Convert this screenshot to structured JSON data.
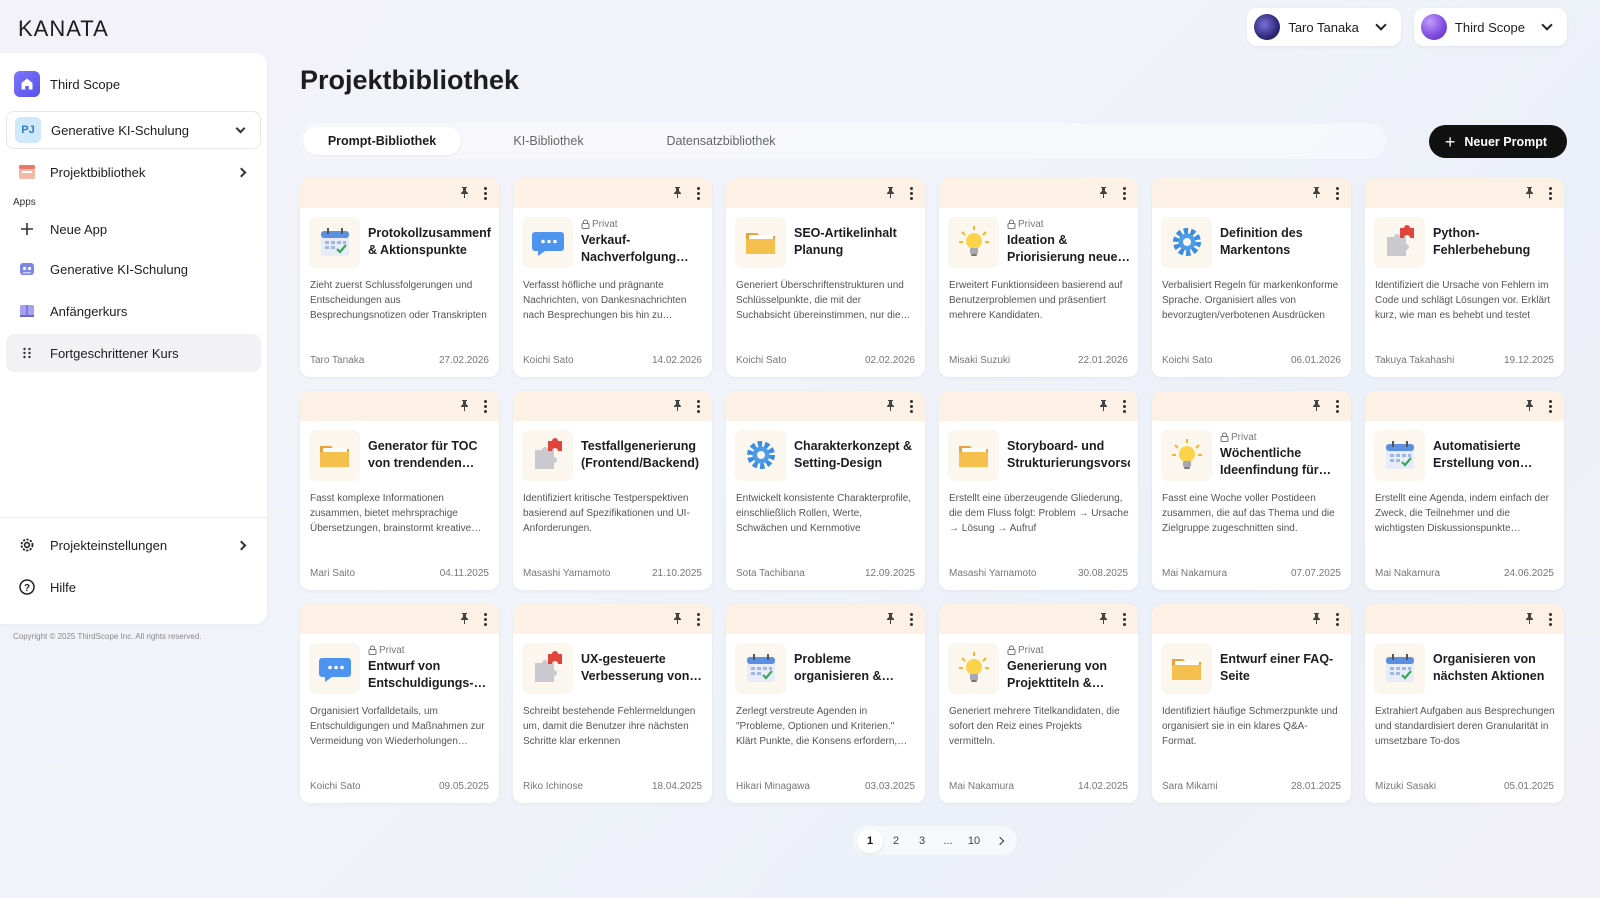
{
  "brand": {
    "logo": "KANATA"
  },
  "header": {
    "user": {
      "name": "Taro Tanaka"
    },
    "scope": {
      "name": "Third Scope"
    }
  },
  "sidebar": {
    "scope_label": "Third Scope",
    "project": {
      "badge": "PJ",
      "name": "Generative KI-Schulung"
    },
    "library": "Projektbibliothek",
    "apps_label": "Apps",
    "apps": [
      {
        "label": "Neue App",
        "icon": "plus-icon"
      },
      {
        "label": "Generative KI-Schulung",
        "icon": "robot-icon"
      },
      {
        "label": "Anfängerkurs",
        "icon": "book-icon"
      },
      {
        "label": "Fortgeschrittener Kurs",
        "icon": "grid-dots-icon"
      }
    ],
    "settings": "Projekteinstellungen",
    "help": "Hilfe",
    "copyright": "Copyright © 2025 ThirdScope Inc. All rights reserved."
  },
  "main": {
    "title": "Projektbibliothek",
    "tabs": [
      "Prompt-Bibliothek",
      "KI-Bibliothek",
      "Datensatzbibliothek"
    ],
    "active_tab": 0,
    "new_button": "Neuer Prompt",
    "private_label": "Privat",
    "cards": [
      {
        "icon": "calendar",
        "private": false,
        "title": "Protokollzusammenfassung & Aktionspunkte",
        "desc": "Zieht zuerst Schlussfolgerungen und Entscheidungen aus Besprechungsnotizen oder Transkripten",
        "author": "Taro Tanaka",
        "date": "27.02.2026"
      },
      {
        "icon": "chat",
        "private": true,
        "title": "Verkauf-Nachverfolgung Dankesnachricht",
        "desc": "Verfasst höfliche und prägnante Nachrichten, von Dankesnachrichten nach Besprechungen bis hin zu Vorschlägen",
        "author": "Koichi Sato",
        "date": "14.02.2026"
      },
      {
        "icon": "folder",
        "private": false,
        "title": "SEO-Artikelinhalt Planung",
        "desc": "Generiert Überschriftenstrukturen und Schlüsselpunkte, die mit der Suchabsicht übereinstimmen, nur die wichtigsten",
        "author": "Koichi Sato",
        "date": "02.02.2026"
      },
      {
        "icon": "bulb",
        "private": true,
        "title": "Ideation & Priorisierung neuer Features",
        "desc": "Erweitert Funktionsideen basierend auf Benutzerproblemen und präsentiert mehrere Kandidaten.",
        "author": "Misaki Suzuki",
        "date": "22.01.2026"
      },
      {
        "icon": "gear",
        "private": false,
        "title": "Definition des Markentons",
        "desc": "Verbalisiert Regeln für markenkonforme Sprache. Organisiert alles von bevorzugten/verbotenen Ausdrücken",
        "author": "Koichi Sato",
        "date": "06.01.2026"
      },
      {
        "icon": "puzzle",
        "private": false,
        "title": "Python-Fehlerbehebung",
        "desc": "Identifiziert die Ursache von Fehlern im Code und schlägt Lösungen vor. Erklärt kurz, wie man es behebt und testet",
        "author": "Takuya Takahashi",
        "date": "19.12.2025"
      },
      {
        "icon": "folder",
        "private": false,
        "title": "Generator für TOC von trendenden Blogartikeln",
        "desc": "Fasst komplexe Informationen zusammen, bietet mehrsprachige Übersetzungen, brainstormt kreative Ideen",
        "author": "Mari Saito",
        "date": "04.11.2025"
      },
      {
        "icon": "puzzle",
        "private": false,
        "title": "Testfallgenerierung (Frontend/Backend)",
        "desc": "Identifiziert kritische Testperspektiven basierend auf Spezifikationen und UI-Anforderungen.",
        "author": "Masashi Yamamoto",
        "date": "21.10.2025"
      },
      {
        "icon": "gear",
        "private": false,
        "title": "Charakterkonzept & Setting-Design",
        "desc": "Entwickelt konsistente Charakterprofile, einschließlich Rollen, Werte, Schwächen und Kernmotive",
        "author": "Sota Tachibana",
        "date": "12.09.2025"
      },
      {
        "icon": "folder",
        "private": false,
        "title": "Storyboard- und Strukturierungsvorschlag",
        "desc": "Erstellt eine überzeugende Gliederung, die dem Fluss folgt: Problem → Ursache → Lösung → Aufruf",
        "author": "Masashi Yamamoto",
        "date": "30.08.2025"
      },
      {
        "icon": "bulb",
        "private": true,
        "title": "Wöchentliche Ideenfindung für soziale Medien",
        "desc": "Fasst eine Woche voller Postideen zusammen, die auf das Thema und die Zielgruppe zugeschnitten sind.",
        "author": "Mai Nakamura",
        "date": "07.07.2025"
      },
      {
        "icon": "calendar",
        "private": false,
        "title": "Automatisierte Erstellung von Besprechungsagenden",
        "desc": "Erstellt eine Agenda, indem einfach der Zweck, die Teilnehmer und die wichtigsten Diskussionspunkte eingegeben werden",
        "author": "Mai Nakamura",
        "date": "24.06.2025"
      },
      {
        "icon": "chat",
        "private": true,
        "title": "Entwurf von Entschuldigungs-E-Mails",
        "desc": "Organisiert Vorfalldetails, um Entschuldigungen und Maßnahmen zur Vermeidung von Wiederholungen darzustellen",
        "author": "Koichi Sato",
        "date": "09.05.2025"
      },
      {
        "icon": "puzzle",
        "private": false,
        "title": "UX-gesteuerte Verbesserung von Fehlermeldungen",
        "desc": "Schreibt bestehende Fehlermeldungen um, damit die Benutzer ihre nächsten Schritte klar erkennen",
        "author": "Riko Ichinose",
        "date": "18.04.2025"
      },
      {
        "icon": "calendar",
        "private": false,
        "title": "Probleme organisieren & Entscheidungen treffen",
        "desc": "Zerlegt verstreute Agenden in \"Probleme, Optionen und Kriterien.\" Klärt Punkte, die Konsens erfordern, und",
        "author": "Hikari Minagawa",
        "date": "03.03.2025"
      },
      {
        "icon": "bulb",
        "private": true,
        "title": "Generierung von Projekttiteln & Slogans",
        "desc": "Generiert mehrere Titelkandidaten, die sofort den Reiz eines Projekts vermitteln.",
        "author": "Mai Nakamura",
        "date": "14.02.2025"
      },
      {
        "icon": "folder",
        "private": false,
        "title": "Entwurf einer FAQ-Seite",
        "desc": "Identifiziert häufige Schmerzpunkte und organisiert sie in ein klares Q&A-Format.",
        "author": "Sara Mikami",
        "date": "28.01.2025"
      },
      {
        "icon": "calendar",
        "private": false,
        "title": "Organisieren von nächsten Aktionen",
        "desc": "Extrahiert Aufgaben aus Besprechungen und standardisiert deren Granularität in umsetzbare To-dos",
        "author": "Mizuki Sasaki",
        "date": "05.01.2025"
      }
    ]
  },
  "pagination": {
    "pages": [
      "1",
      "2",
      "3",
      "...",
      "10"
    ],
    "current": "1"
  }
}
